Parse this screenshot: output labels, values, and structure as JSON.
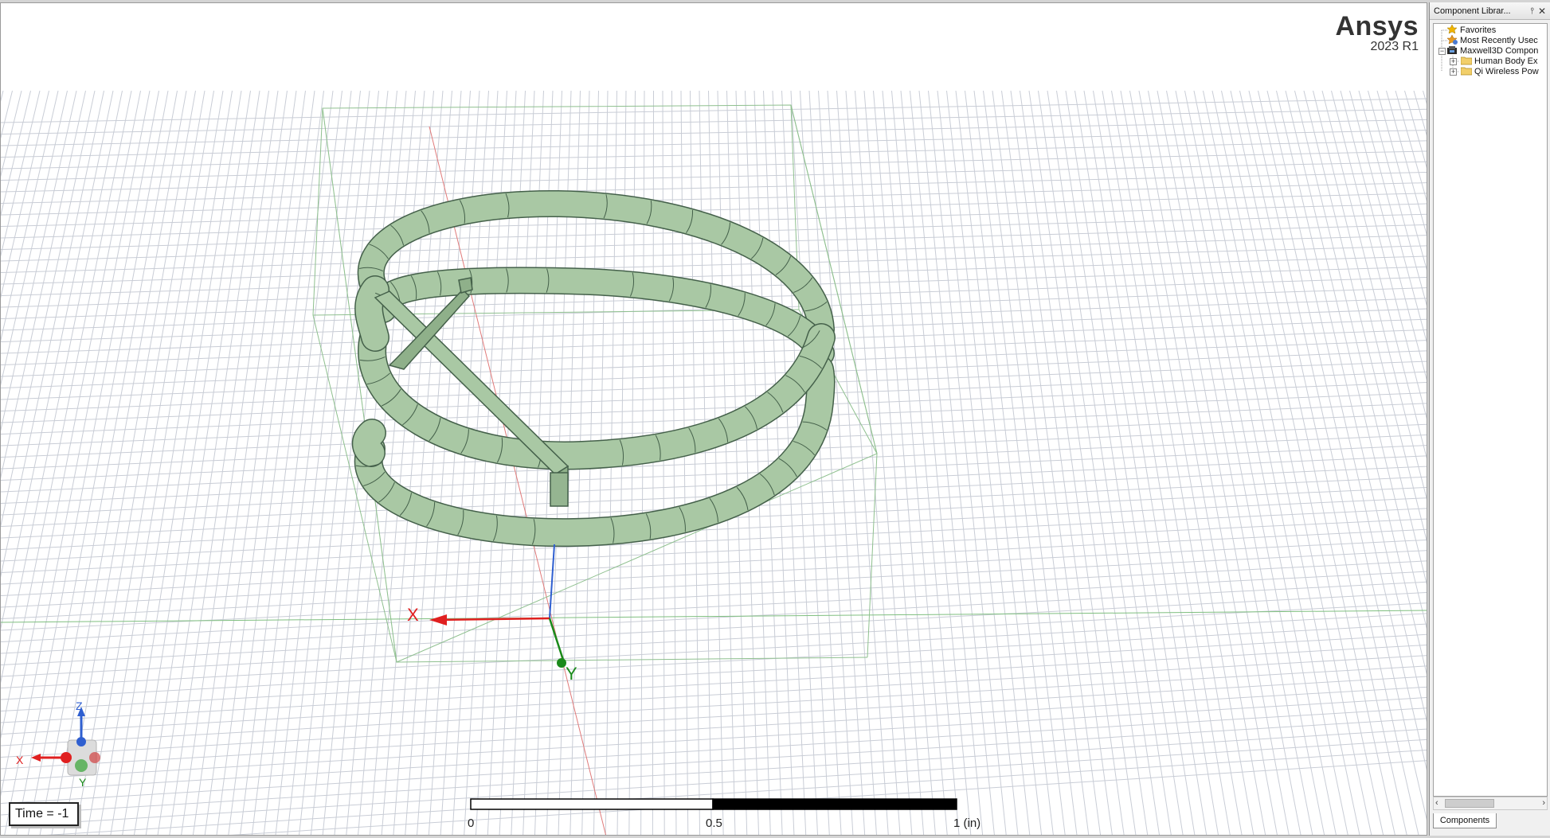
{
  "brand": {
    "name": "Ansys",
    "version": "2023 R1"
  },
  "viewport": {
    "time_label": "Time = -1",
    "axes": {
      "x": "X",
      "y": "Y"
    },
    "triad": {
      "x": "X",
      "y": "Y",
      "z": "Z"
    },
    "ruler": {
      "labels": [
        "0",
        "0.5",
        "1 (in)"
      ]
    }
  },
  "panel": {
    "title": "Component Librar...",
    "pin_icon": "pin-icon",
    "close_icon": "close-icon",
    "tree": [
      {
        "label": "Favorites",
        "icon": "favorites-icon",
        "expander": ""
      },
      {
        "label": "Most Recently Usec",
        "icon": "recent-icon",
        "expander": ""
      },
      {
        "label": "Maxwell3D Compon",
        "icon": "component-library-icon",
        "expander": "−"
      },
      {
        "label": "Human Body Ex",
        "icon": "folder-icon",
        "expander": "+"
      },
      {
        "label": "Qi Wireless Pow",
        "icon": "folder-icon",
        "expander": "+"
      }
    ],
    "tab": "Components"
  },
  "colors": {
    "grid": "#c9cdd6",
    "coil_fill": "#a9c8a4",
    "coil_stroke": "#44604a",
    "axis_x": "#e02020",
    "axis_y": "#1a8a1a",
    "axis_z": "#2f5fd0"
  }
}
